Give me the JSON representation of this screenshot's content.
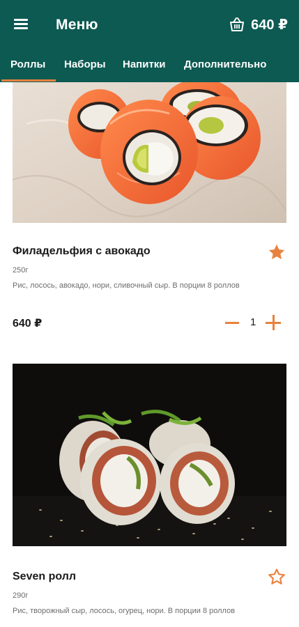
{
  "app": {
    "title": "Меню",
    "cart_total": "640 ₽",
    "cart_icon": "basket-icon",
    "menu_icon": "hamburger-menu-icon"
  },
  "tabs": [
    {
      "label": "Роллы",
      "active": true
    },
    {
      "label": "Наборы",
      "active": false
    },
    {
      "label": "Напитки",
      "active": false
    },
    {
      "label": "Дополнительно",
      "active": false
    }
  ],
  "colors": {
    "primary": "#0c5a52",
    "accent": "#e8823e"
  },
  "products": [
    {
      "name": "Филадельфия с авокадо",
      "weight": "250г",
      "description": "Рис, лосось, авокадо, нори, сливочный сыр. В порции 8 роллов",
      "price": "640 ₽",
      "quantity": "1",
      "favorite": true,
      "image": "salmon-avocado-rolls-photo"
    },
    {
      "name": "Seven ролл",
      "weight": "290г",
      "description": "Рис, творожный сыр, лосось, огурец, нори. В порции 8 роллов",
      "favorite": false,
      "image": "seven-rolls-photo"
    }
  ]
}
